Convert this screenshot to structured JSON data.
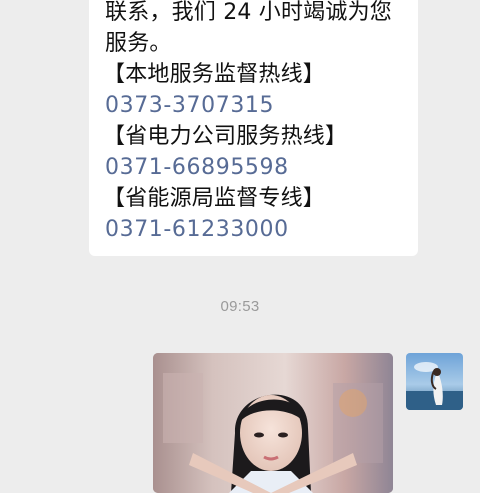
{
  "chat": {
    "received_message": {
      "lines": [
        "联系，我们 24 小时竭诚为您",
        "服务。",
        "【本地服务监督热线】",
        "0373-3707315",
        "【省电力公司服务热线】",
        "0371-66895598",
        "【省能源局监督专线】",
        "0371-61233000"
      ]
    },
    "timestamp": "09:53",
    "sent_message": {
      "type": "image",
      "description_icon": "image-thumbnail"
    }
  },
  "colors": {
    "background": "#ededed",
    "bubble_received": "#ffffff",
    "link_phone": "#576b95",
    "timestamp": "#9a9a9a"
  }
}
